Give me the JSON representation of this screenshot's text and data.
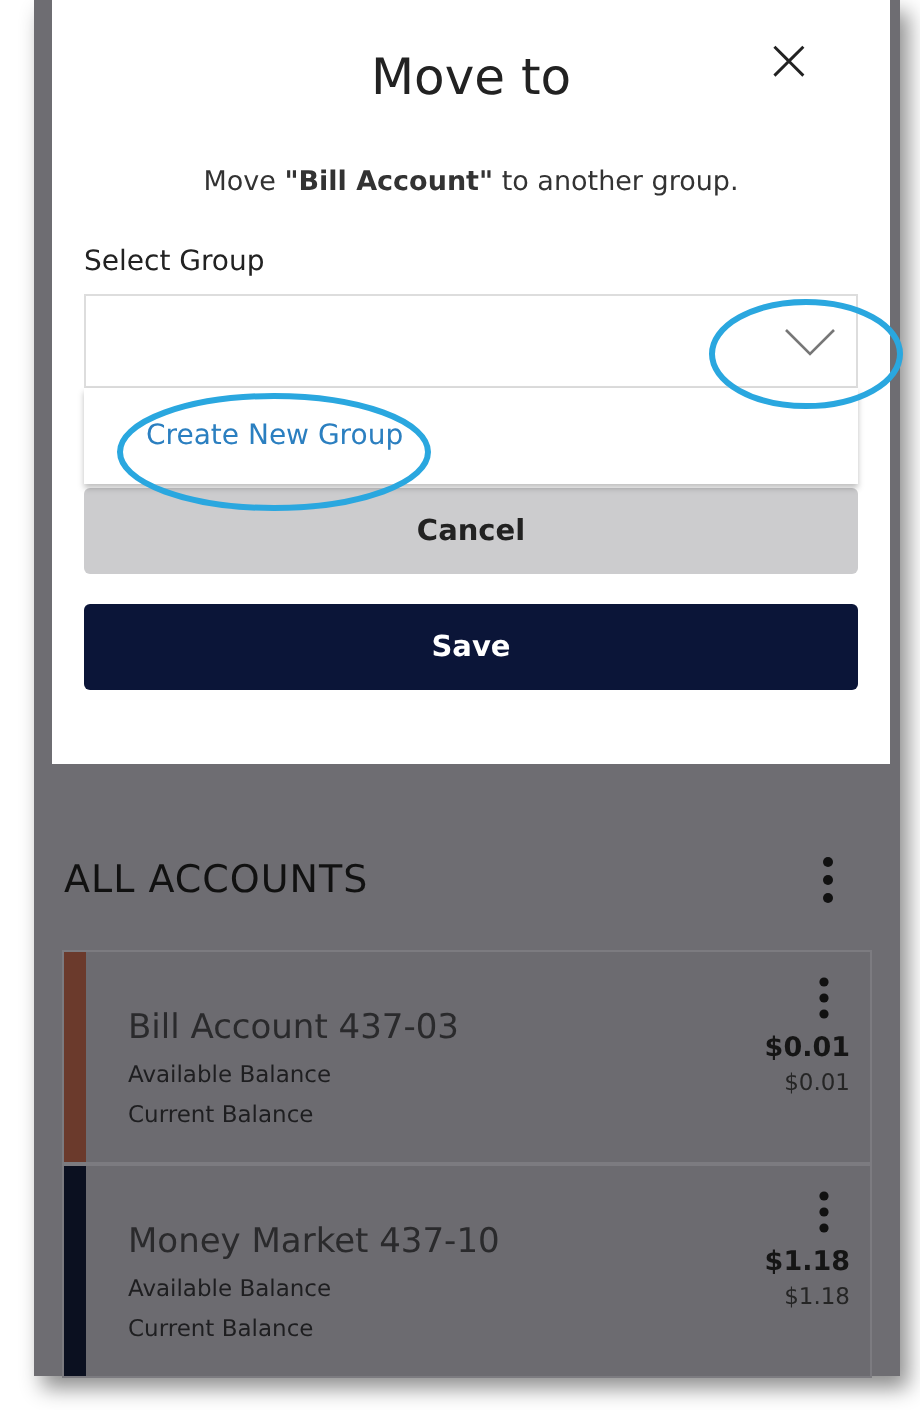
{
  "dialog": {
    "title": "Move to",
    "close": "×",
    "message": "Move **\"Bill Account\"** to another group.",
    "field_label": "Select Group",
    "dropdown": {
      "expanded": true,
      "options": [
        "Create New Group"
      ]
    },
    "buttons": [
      {
        "label": "Cancel",
        "kind": "secondary"
      },
      {
        "label": "Save",
        "kind": "primary"
      }
    ]
  },
  "background": {
    "section_title": "ALL ACCOUNTS",
    "accounts": [
      {
        "name": "Bill Account 437-03",
        "color": "#6b3a2c",
        "available_label": "Available Balance",
        "available": "$0.01",
        "current_label": "Current Balance",
        "current": "$0.01"
      },
      {
        "name": "Money Market 437-10",
        "color": "#0b1020",
        "available_label": "Available Balance",
        "available": "$1.18",
        "current_label": "Current Balance",
        "current": "$1.18"
      }
    ]
  }
}
